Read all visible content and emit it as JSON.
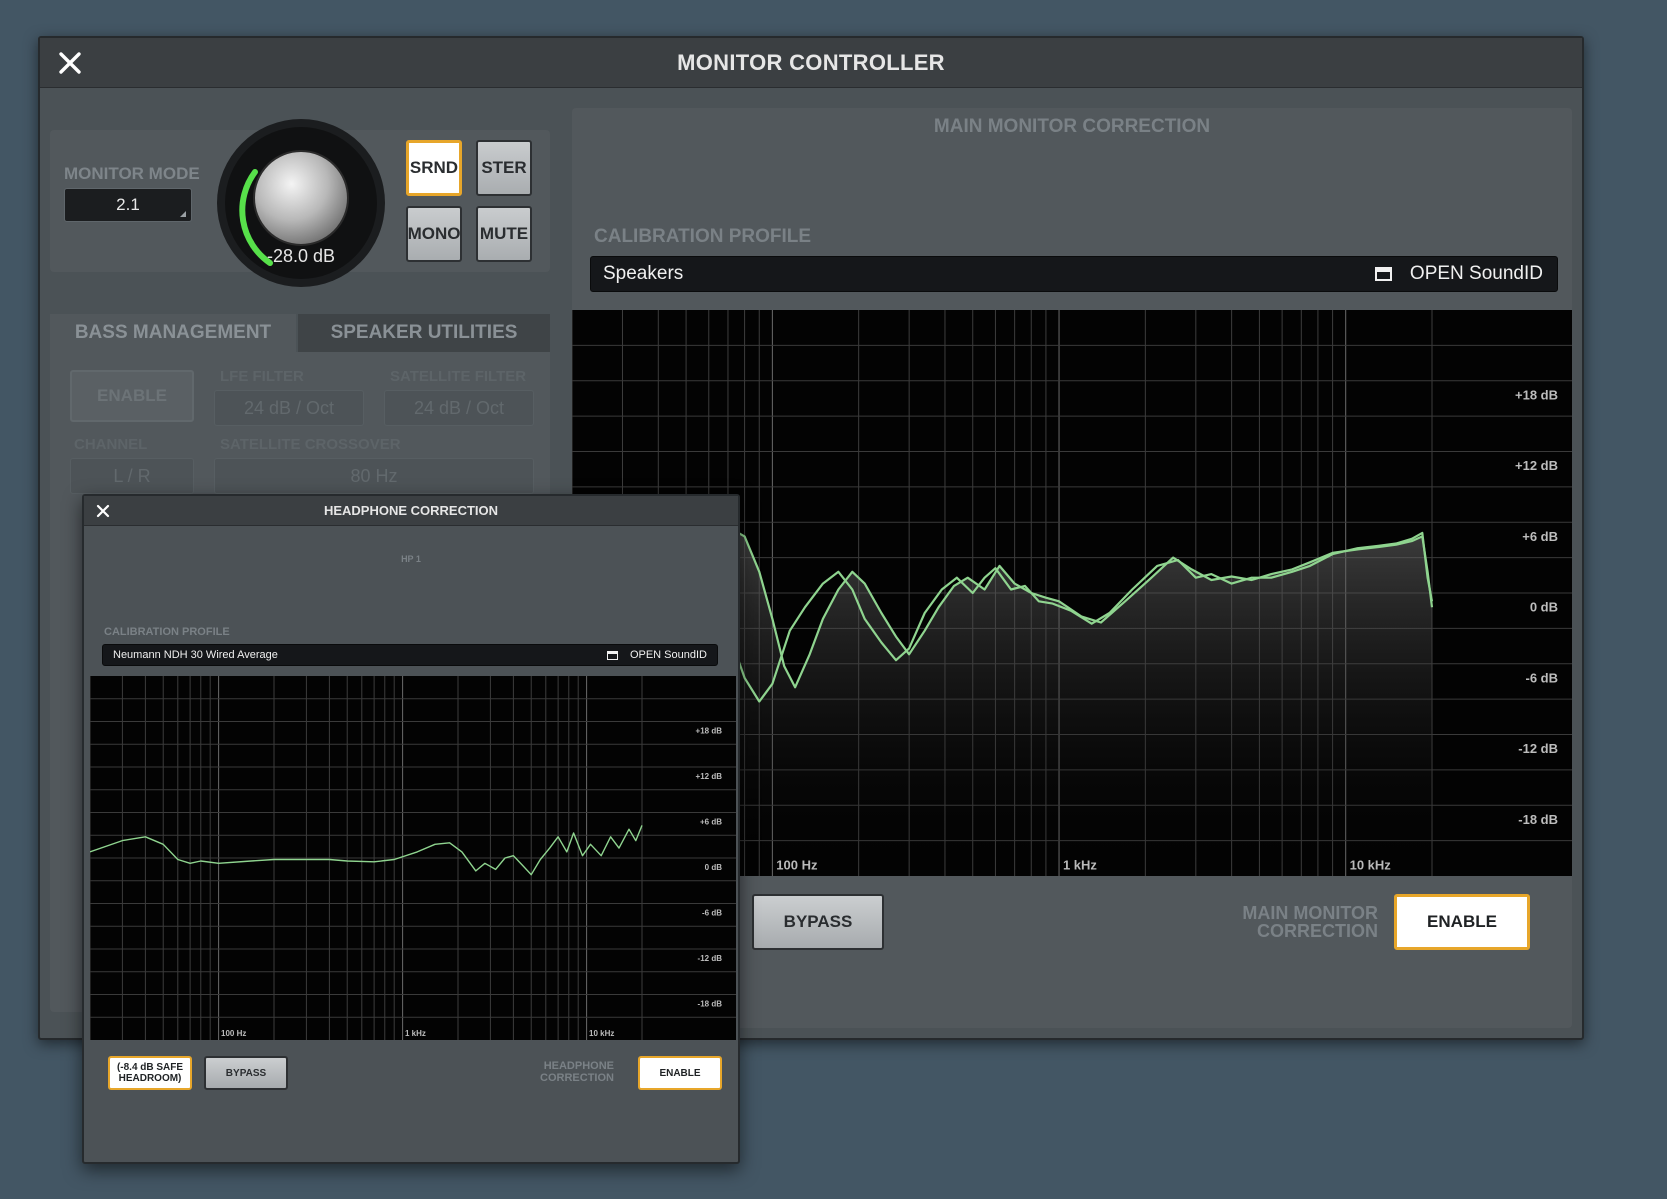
{
  "main_window": {
    "title": "MONITOR CONTROLLER",
    "monitor_mode": {
      "label": "MONITOR MODE",
      "value": "2.1"
    },
    "volume": {
      "display": "-28.0 dB"
    },
    "mode_buttons": {
      "srnd": "SRND",
      "ster": "STER",
      "mono": "MONO",
      "mute": "MUTE"
    },
    "tabs": {
      "bass": "BASS MANAGEMENT",
      "utilities": "SPEAKER UTILITIES"
    },
    "bass_management": {
      "enable": "ENABLE",
      "lfe_filter_label": "LFE FILTER",
      "lfe_filter_value": "24 dB / Oct",
      "satellite_filter_label": "SATELLITE FILTER",
      "satellite_filter_value": "24 dB / Oct",
      "channel_label": "CHANNEL",
      "channel_value": "L / R",
      "crossover_label": "SATELLITE CROSSOVER",
      "crossover_value": "80 Hz"
    },
    "correction": {
      "header": "MAIN MONITOR CORRECTION",
      "profile_label": "CALIBRATION PROFILE",
      "profile_value": "Speakers",
      "open_label": "OPEN SoundID",
      "db_labels": [
        "+18 dB",
        "+12 dB",
        "+6 dB",
        "0 dB",
        "-6 dB",
        "-12 dB",
        "-18 dB"
      ],
      "freq_labels": [
        "100 Hz",
        "1 kHz",
        "10 kHz"
      ],
      "bypass": "BYPASS",
      "status_label_line1": "MAIN MONITOR",
      "status_label_line2": "CORRECTION",
      "enable": "ENABLE",
      "curve_color": "#8fd48f"
    }
  },
  "headphone_window": {
    "title": "HEADPHONE CORRECTION",
    "output_label": "HP 1",
    "profile_label": "CALIBRATION PROFILE",
    "profile_value": "Neumann NDH 30 Wired Average",
    "open_label": "OPEN SoundID",
    "db_labels": [
      "+18 dB",
      "+12 dB",
      "+6 dB",
      "0 dB",
      "-6 dB",
      "-12 dB",
      "-18 dB"
    ],
    "freq_labels": [
      "100 Hz",
      "1 kHz",
      "10 kHz"
    ],
    "headroom_line1": "(-8.4 dB SAFE",
    "headroom_line2": "HEADROOM)",
    "bypass": "BYPASS",
    "status_label_line1": "HEADPHONE",
    "status_label_line2": "CORRECTION",
    "enable": "ENABLE"
  },
  "icons": {
    "close": "close-icon",
    "open": "open-window-icon",
    "knob": "volume-knob"
  },
  "colors": {
    "accent": "#e7a62a",
    "knob_ring": "#57e04a",
    "curve": "#8fd48f",
    "background": "#435664"
  }
}
